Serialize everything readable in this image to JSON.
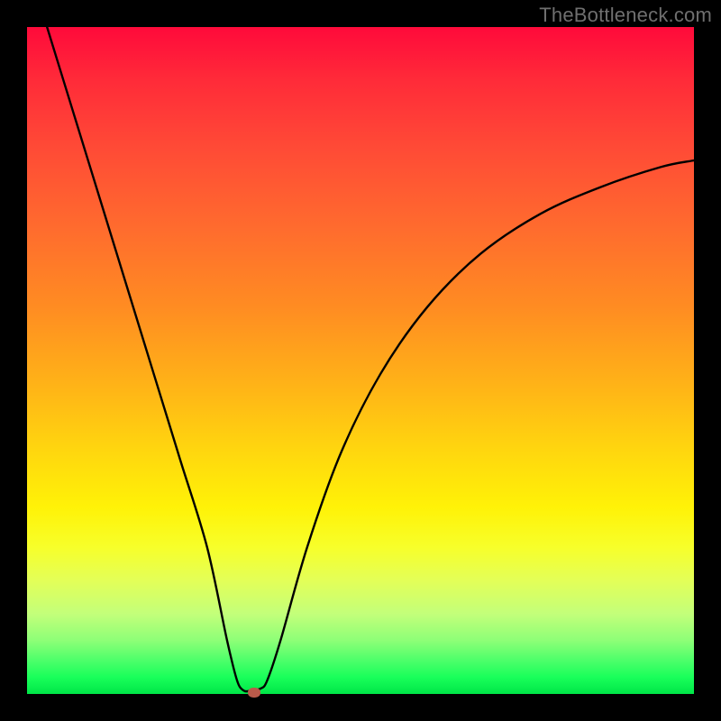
{
  "watermark": "TheBottleneck.com",
  "chart_data": {
    "type": "line",
    "title": "",
    "xlabel": "",
    "ylabel": "",
    "xlim": [
      0,
      100
    ],
    "ylim": [
      0,
      100
    ],
    "grid": false,
    "legend": false,
    "series": [
      {
        "name": "curve",
        "x": [
          3,
          7,
          11,
          15,
          19,
          23,
          27,
          30,
          31.5,
          32.5,
          33.5,
          35,
          36,
          38,
          42,
          47,
          53,
          60,
          68,
          77,
          86,
          95,
          100
        ],
        "y": [
          100,
          87,
          74,
          61,
          48,
          35,
          22,
          8,
          2,
          0.5,
          0.5,
          0.8,
          2,
          8,
          22,
          36,
          48,
          58,
          66,
          72,
          76,
          79,
          80
        ]
      }
    ],
    "marker": {
      "x": 34,
      "y": 0.3
    },
    "gradient_stops": [
      {
        "pos": 0,
        "color": "#ff0a3a"
      },
      {
        "pos": 50,
        "color": "#ffb417"
      },
      {
        "pos": 75,
        "color": "#fff207"
      },
      {
        "pos": 100,
        "color": "#00e648"
      }
    ]
  }
}
